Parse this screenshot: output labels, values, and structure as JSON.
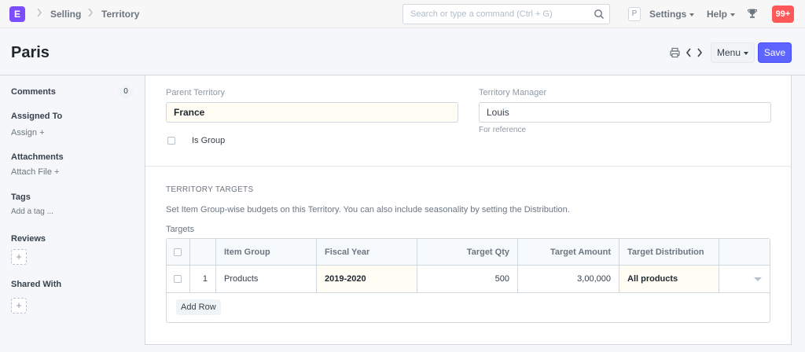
{
  "navbar": {
    "logo_letter": "E",
    "breadcrumbs": [
      "Selling",
      "Territory"
    ],
    "search_placeholder": "Search or type a command (Ctrl + G)",
    "avatar_letter": "P",
    "settings_label": "Settings",
    "help_label": "Help",
    "notifications": "99+"
  },
  "page": {
    "title": "Paris",
    "menu_label": "Menu",
    "save_label": "Save"
  },
  "sidebar": {
    "comments_label": "Comments",
    "comments_count": "0",
    "assigned_label": "Assigned To",
    "assign_link": "Assign",
    "attachments_label": "Attachments",
    "attach_link": "Attach File",
    "tags_label": "Tags",
    "add_tag_link": "Add a tag ...",
    "reviews_label": "Reviews",
    "shared_label": "Shared With"
  },
  "form": {
    "parent_territory_label": "Parent Territory",
    "parent_territory_value": "France",
    "is_group_label": "Is Group",
    "territory_manager_label": "Territory Manager",
    "territory_manager_value": "Louis",
    "territory_manager_help": "For reference",
    "section_title": "TERRITORY TARGETS",
    "section_desc": "Set Item Group-wise budgets on this Territory. You can also include seasonality by setting the Distribution.",
    "targets_label": "Targets",
    "add_row_label": "Add Row"
  },
  "targets_table": {
    "columns": [
      "Item Group",
      "Fiscal Year",
      "Target Qty",
      "Target Amount",
      "Target Distribution"
    ],
    "rows": [
      {
        "idx": "1",
        "item_group": "Products",
        "fiscal_year": "2019-2020",
        "target_qty": "500",
        "target_amount": "3,00,000",
        "target_distribution": "All products"
      }
    ]
  }
}
